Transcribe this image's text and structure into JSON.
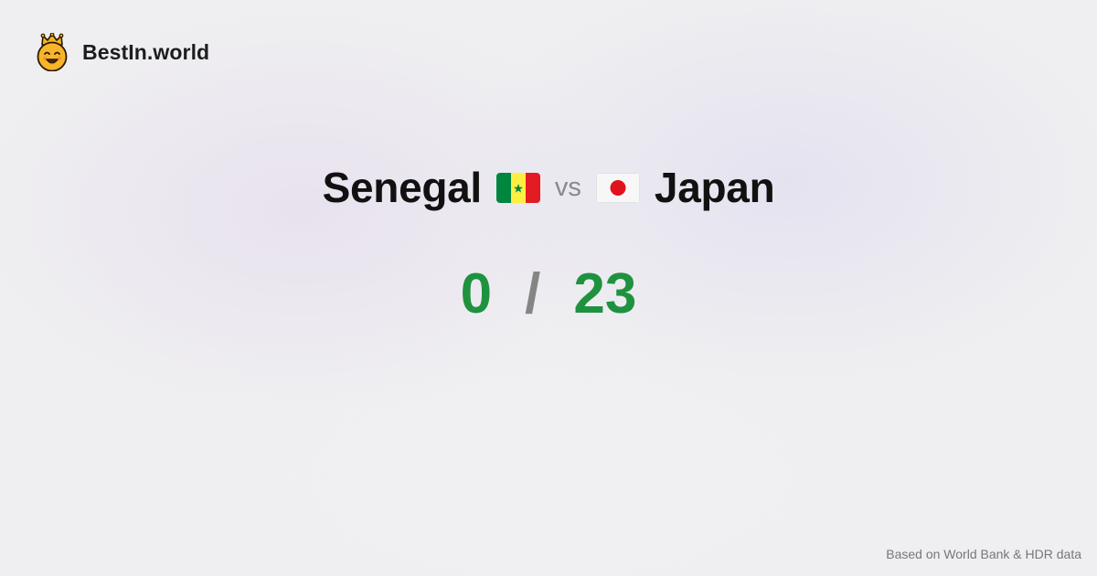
{
  "brand": {
    "name": "BestIn.world",
    "logo_icon": "crown-smiley-icon"
  },
  "comparison": {
    "left": {
      "country": "Senegal",
      "flag_icon": "senegal-flag-icon",
      "score": "0"
    },
    "vs_label": "vs",
    "right": {
      "country": "Japan",
      "flag_icon": "japan-flag-icon",
      "score": "23"
    },
    "separator": "/"
  },
  "footer": {
    "source_note": "Based on World Bank & HDR data"
  },
  "colors": {
    "score_green": "#1f9240",
    "separator_gray": "#858585",
    "vs_gray": "#8a8a8e",
    "senegal_green": "#00853f",
    "senegal_yellow": "#fdef42",
    "senegal_red": "#e31b23",
    "japan_red": "#e0121b"
  }
}
